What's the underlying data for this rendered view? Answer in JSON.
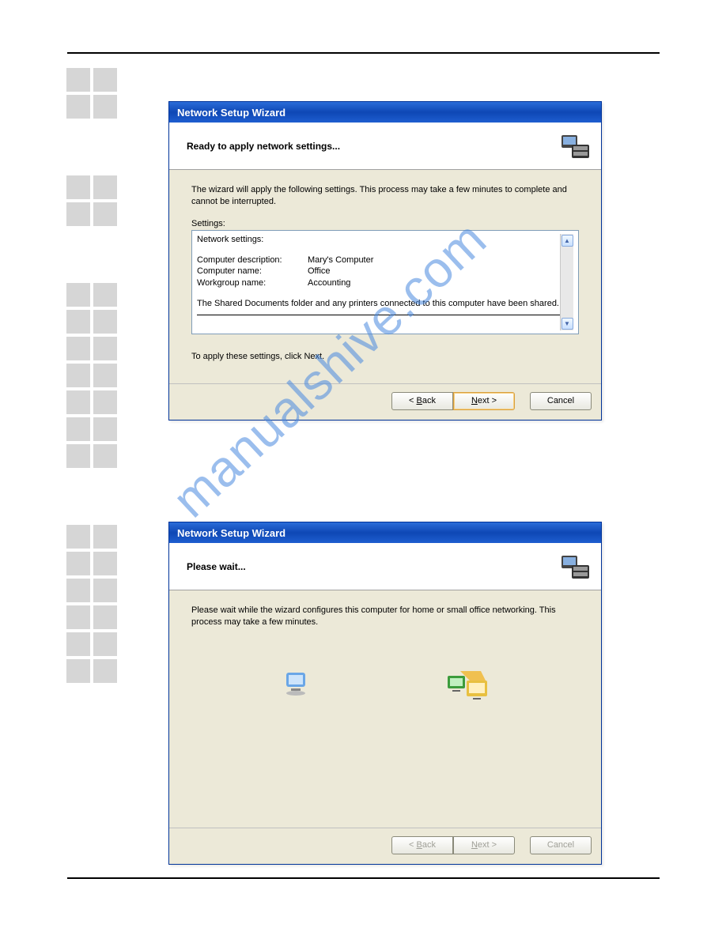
{
  "watermark": "manualshive.com",
  "wizard1": {
    "title": "Network Setup Wizard",
    "header": "Ready to apply network settings...",
    "intro": "The wizard will apply the following settings. This process may take a few minutes to complete and cannot be interrupted.",
    "settingsLabel": "Settings:",
    "settings": {
      "heading": "Network settings:",
      "rows": [
        {
          "key": "Computer description:",
          "value": "Mary's Computer"
        },
        {
          "key": "Computer name:",
          "value": "Office"
        },
        {
          "key": "Workgroup name:",
          "value": "Accounting"
        }
      ],
      "footer": "The Shared Documents folder and any printers connected to this computer have been shared."
    },
    "applyHint": "To apply these settings, click Next.",
    "buttons": {
      "back": "Back",
      "next": "Next >",
      "cancel": "Cancel"
    }
  },
  "wizard2": {
    "title": "Network Setup Wizard",
    "header": "Please wait...",
    "body": "Please wait while the wizard configures this computer for home or small office networking. This process may take a few minutes.",
    "buttons": {
      "back": "Back",
      "next": "Next >",
      "cancel": "Cancel"
    }
  }
}
